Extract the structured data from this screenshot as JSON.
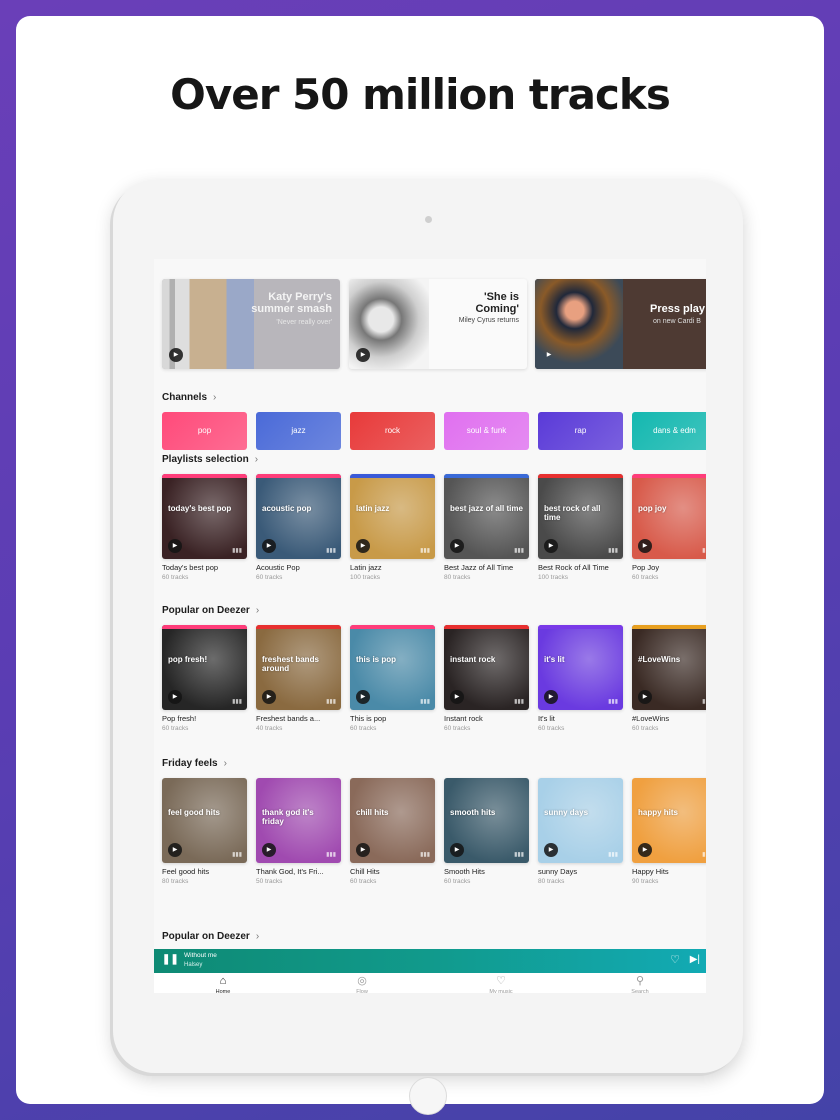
{
  "headline": "Over 50 million tracks",
  "heroes": [
    {
      "title": "Katy Perry's summer smash",
      "subtitle": "'Never really over'",
      "play_icon": "play-icon"
    },
    {
      "title": "'She is Coming'",
      "subtitle": "Miley Cyrus returns",
      "play_icon": "play-icon"
    },
    {
      "title": "Press play",
      "subtitle": "on new Cardi B",
      "play_icon": "play-icon"
    }
  ],
  "channels": {
    "title": "Channels",
    "chevron": "›",
    "items": [
      {
        "label": "pop",
        "color": "#ff4a7a"
      },
      {
        "label": "jazz",
        "color": "#4a6ad8"
      },
      {
        "label": "rock",
        "color": "#e83a3a"
      },
      {
        "label": "soul & funk",
        "color": "#e070f0"
      },
      {
        "label": "rap",
        "color": "#5a3ad8"
      },
      {
        "label": "dans & edm",
        "color": "#14b8b0"
      }
    ]
  },
  "sections": [
    {
      "title": "Playlists selection",
      "chevron": "›",
      "items": [
        {
          "cover_text": "today's best pop",
          "name": "Today's best pop",
          "count": "60 tracks",
          "bar": "#ff3d7a",
          "bg": "#3a2224"
        },
        {
          "cover_text": "acoustic pop",
          "name": "Acoustic Pop",
          "count": "60 tracks",
          "bar": "#ff3d7a",
          "bg": "#3a5a78"
        },
        {
          "cover_text": "latin jazz",
          "name": "Latin jazz",
          "count": "100 tracks",
          "bar": "#3a5ad8",
          "bg": "#c89a48"
        },
        {
          "cover_text": "best jazz of all time",
          "name": "Best Jazz of All Time",
          "count": "80 tracks",
          "bar": "#3a6ad8",
          "bg": "#555555"
        },
        {
          "cover_text": "best rock of all time",
          "name": "Best Rock of All Time",
          "count": "100 tracks",
          "bar": "#e83030",
          "bg": "#4a4a4a"
        },
        {
          "cover_text": "pop joy",
          "name": "Pop Joy",
          "count": "60 tracks",
          "bar": "#ff3d7a",
          "bg": "#d85a4a"
        }
      ]
    },
    {
      "title": "Popular on Deezer",
      "chevron": "›",
      "items": [
        {
          "cover_text": "pop fresh!",
          "name": "Pop fresh!",
          "count": "60 tracks",
          "bar": "#ff3d7a",
          "bg": "#262626"
        },
        {
          "cover_text": "freshest bands around",
          "name": "Freshest bands a...",
          "count": "40 tracks",
          "bar": "#e83030",
          "bg": "#8a6a40"
        },
        {
          "cover_text": "this is pop",
          "name": "This is pop",
          "count": "60 tracks",
          "bar": "#ff3d7a",
          "bg": "#4a8aa8"
        },
        {
          "cover_text": "instant rock",
          "name": "Instant rock",
          "count": "60 tracks",
          "bar": "#e83030",
          "bg": "#2a2424"
        },
        {
          "cover_text": "it's lit",
          "name": "It's lit",
          "count": "60 tracks",
          "bar": "#7a3ae8",
          "bg": "#6a3ae0"
        },
        {
          "cover_text": "#LoveWins",
          "name": "#LoveWins",
          "count": "60 tracks",
          "bar": "#e8a020",
          "bg": "#3a2a24"
        }
      ]
    },
    {
      "title": "Friday feels",
      "chevron": "›",
      "items": [
        {
          "cover_text": "feel good hits",
          "name": "Feel good hits",
          "count": "80 tracks",
          "bar": "",
          "bg": "#7a6a58"
        },
        {
          "cover_text": "thank god it's friday",
          "name": "Thank God, It's Fri...",
          "count": "50 tracks",
          "bar": "",
          "bg": "#a04ab0"
        },
        {
          "cover_text": "chill hits",
          "name": "Chill Hits",
          "count": "60 tracks",
          "bar": "",
          "bg": "#8a6a5a"
        },
        {
          "cover_text": "smooth hits",
          "name": "Smooth Hits",
          "count": "60 tracks",
          "bar": "",
          "bg": "#3a5a6a"
        },
        {
          "cover_text": "sunny days",
          "name": "sunny Days",
          "count": "80 tracks",
          "bar": "",
          "bg": "#a8d0e8"
        },
        {
          "cover_text": "happy hits",
          "name": "Happy Hits",
          "count": "90 tracks",
          "bar": "",
          "bg": "#f0a040"
        }
      ]
    }
  ],
  "next_section": {
    "title": "Popular on Deezer",
    "chevron": "›"
  },
  "player": {
    "track": "Without me",
    "artist": "Halsey",
    "pause_icon": "❚❚",
    "heart_icon": "♡",
    "next_icon": "▶|"
  },
  "tabs": [
    {
      "label": "Home",
      "icon": "⌂",
      "active": true
    },
    {
      "label": "Flow",
      "icon": "◎",
      "active": false
    },
    {
      "label": "My music",
      "icon": "♡",
      "active": false
    },
    {
      "label": "Search",
      "icon": "⚲",
      "active": false
    }
  ]
}
